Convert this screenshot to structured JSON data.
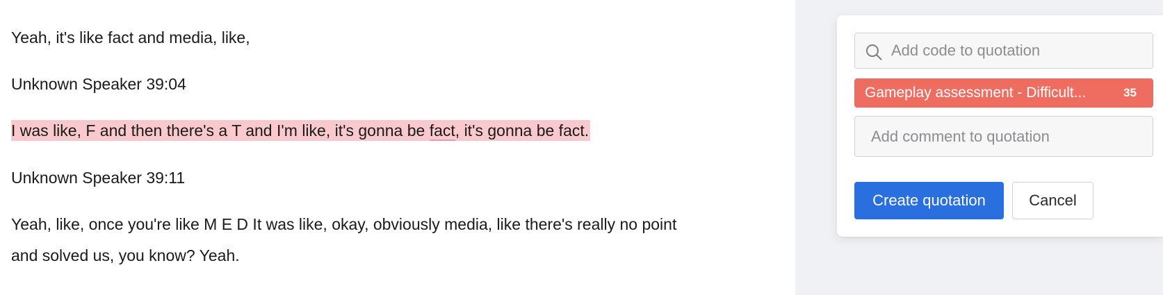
{
  "transcript": {
    "line1": "Yeah, it's like fact and media, like,",
    "speaker1": "Unknown Speaker 39:04",
    "highlight": {
      "before": "I was like, F and then there's a T and I'm like, it's gonna be ",
      "flagged_word": "fact",
      "after": ", it's gonna be fact."
    },
    "speaker2": "Unknown Speaker 39:11",
    "para_line1": "Yeah, like, once you're like M E D It was like, okay, obviously media, like there's really no point",
    "para_line2": "and solved us, you know? Yeah."
  },
  "quotation_panel": {
    "search_placeholder": "Add code to quotation",
    "code_chip": {
      "label": "Gameplay assessment - Difficult...",
      "count": "35",
      "color": "#ee6d60"
    },
    "comment_placeholder": "Add comment to quotation",
    "create_button": "Create quotation",
    "cancel_button": "Cancel"
  },
  "colors": {
    "highlight": "#f9c9cd",
    "primary_button": "#2a6fdf",
    "sidebar_bg": "#f0f1f4"
  }
}
